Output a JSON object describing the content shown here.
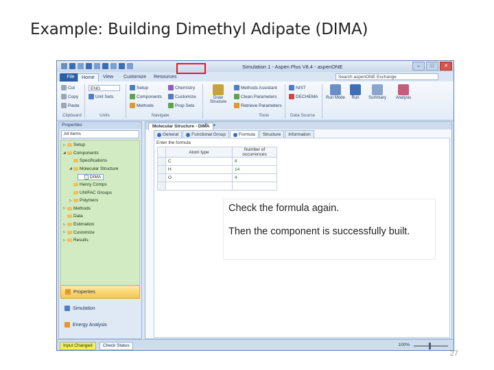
{
  "slide": {
    "title": "Example: Building Dimethyl Adipate (DIMA)",
    "page_number": "27"
  },
  "window": {
    "title": "Simulation 1 - Aspen Plus V8.4 - aspenONE",
    "controls": [
      "–",
      "□",
      "✕"
    ],
    "tabs": [
      "File",
      "Home",
      "View",
      "Customize",
      "Resources"
    ],
    "active_tab": "Home",
    "search_placeholder": "Search aspenONE Exchange"
  },
  "ribbon": {
    "clipboard": {
      "cut": "Cut",
      "copy": "Copy",
      "paste": "Paste",
      "group": "Clipboard"
    },
    "units": {
      "unit_set": "ENG",
      "unit_sets": "Unit Sets",
      "group": "Units"
    },
    "navigate": {
      "setup": "Setup",
      "components": "Components",
      "methods": "Methods",
      "chemistry": "Chemistry",
      "customize": "Customize",
      "prop_sets": "Prop Sets",
      "group": "Navigate"
    },
    "tools": {
      "draw_structure": "Draw Structure",
      "nist": "NIST",
      "methods_assistant": "Methods Assistant",
      "clean_parameters": "Clean Parameters",
      "retrieve_parameters": "Retrieve Parameters",
      "dechema": "DECHEMA",
      "group": "Tools"
    },
    "data_source": {
      "group": "Data Source"
    },
    "run": {
      "run_mode": "Run Mode",
      "run": "Run",
      "summary": "Summary",
      "analysis": "Analysis"
    }
  },
  "navigation": {
    "header": "Properties",
    "filter": "All Items",
    "tree": [
      {
        "label": "Setup",
        "level": 0,
        "expander": "▷"
      },
      {
        "label": "Components",
        "level": 0,
        "expander": "◢"
      },
      {
        "label": "Specifications",
        "level": 1,
        "expander": ""
      },
      {
        "label": "Molecular Structure",
        "level": 1,
        "expander": "◢"
      },
      {
        "label": "DIMA",
        "level": 2,
        "expander": ""
      },
      {
        "label": "Henry Comps",
        "level": 1,
        "expander": ""
      },
      {
        "label": "UNIFAC Groups",
        "level": 1,
        "expander": ""
      },
      {
        "label": "Polymers",
        "level": 1,
        "expander": "▷"
      },
      {
        "label": "Methods",
        "level": 0,
        "expander": "▷"
      },
      {
        "label": "Data",
        "level": 0,
        "expander": ""
      },
      {
        "label": "Estimation",
        "level": 0,
        "expander": "▷"
      },
      {
        "label": "Customize",
        "level": 0,
        "expander": "▷"
      },
      {
        "label": "Results",
        "level": 0,
        "expander": "▷"
      }
    ],
    "buttons": [
      "Properties",
      "Simulation",
      "Energy Analysis"
    ]
  },
  "editor": {
    "doc_tab": "Molecular Structure - DIMA",
    "form_tabs": [
      "General",
      "Functional Group",
      "Formula",
      "Structure",
      "Information"
    ],
    "active_form_tab": "Formula",
    "enter_label": "Enter the formula",
    "columns": [
      "Atom type",
      "Number of occurrences"
    ],
    "rows": [
      {
        "atom": "C",
        "count": "8"
      },
      {
        "atom": "H",
        "count": "14"
      },
      {
        "atom": "O",
        "count": "4"
      }
    ]
  },
  "status": {
    "input_changed": "Input Changed",
    "check_status": "Check Status",
    "zoom": "100%"
  },
  "callout": {
    "line1": "Check the formula again.",
    "line2": "Then the component is successfully built."
  },
  "colors": {
    "highlight": "#e01818",
    "nav_tree_bg": "#d3ebc2",
    "status_yellow": "#f5f04a"
  }
}
